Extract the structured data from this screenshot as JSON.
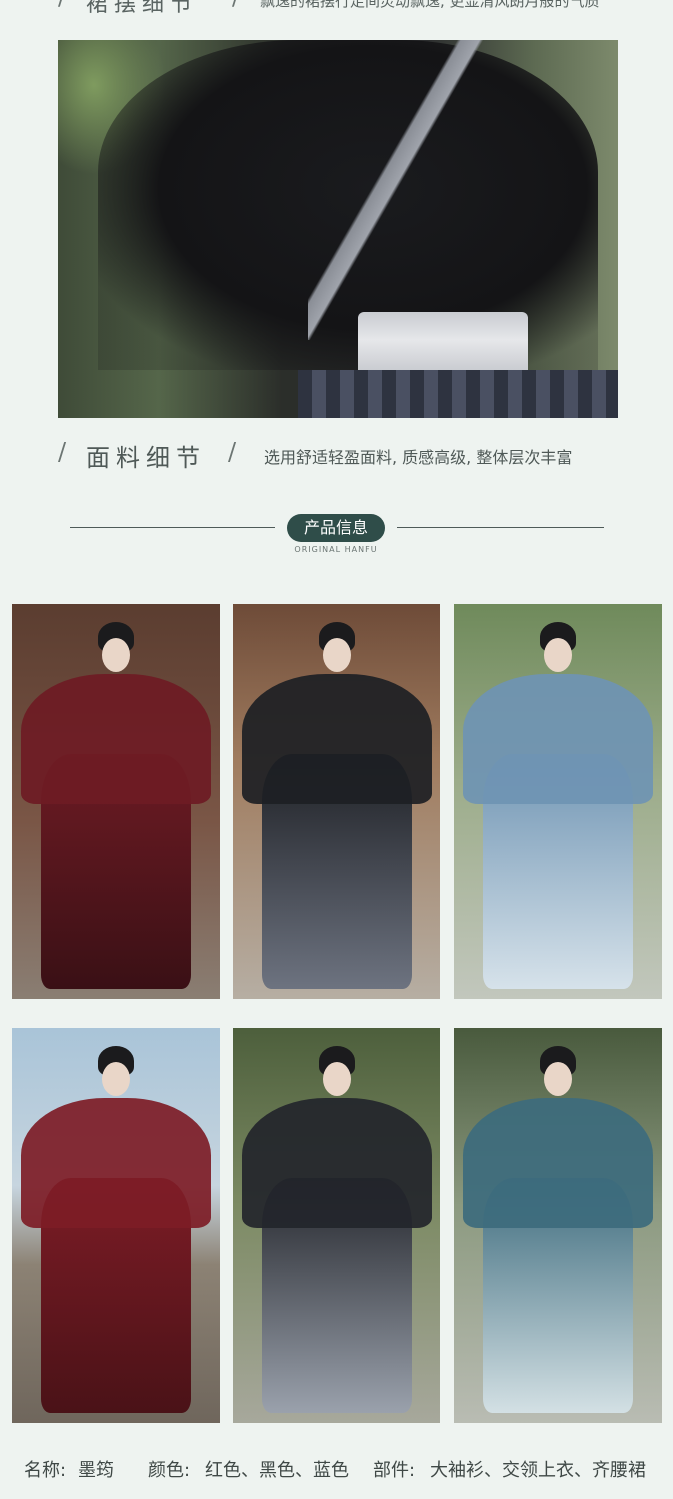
{
  "top_header": {
    "slash_left": "/",
    "title": "裙摆细节",
    "slash_right": "/",
    "desc": "飘逸的裙摆行走间灵动飘逸, 更显清风朗月般的气质"
  },
  "fabric": {
    "slash_left": "/",
    "title": "面料细节",
    "slash_right": "/",
    "desc": "选用舒适轻盈面料, 质感高级, 整体层次丰富"
  },
  "product_info": {
    "title": "产品信息",
    "subtitle": "ORIGINAL HANFU"
  },
  "photos": [
    {
      "name": "red-hanfu-photo",
      "dress": "#6e1b24",
      "skirt": "#3a1015"
    },
    {
      "name": "black-hanfu-photo",
      "dress": "#1d1f24",
      "skirt": "#6d7380"
    },
    {
      "name": "blue-hanfu-photo",
      "dress": "#6f94b3",
      "skirt": "#d6e2ea"
    },
    {
      "name": "red-hanfu-seated-photo",
      "dress": "#7d1c26",
      "skirt": "#4a1217"
    },
    {
      "name": "black-hanfu-bamboo-photo",
      "dress": "#23252b",
      "skirt": "#9aa1ac"
    },
    {
      "name": "blue-hanfu-bamboo-photo",
      "dress": "#3d6b7d",
      "skirt": "#d3e0e4"
    }
  ],
  "specs": {
    "name_label": "名称:",
    "name_value": "墨筠",
    "color_label": "颜色:",
    "color_value": "红色、黑色、蓝色",
    "parts_label": "部件:",
    "parts_value": "大袖衫、交领上衣、齐腰裙"
  }
}
